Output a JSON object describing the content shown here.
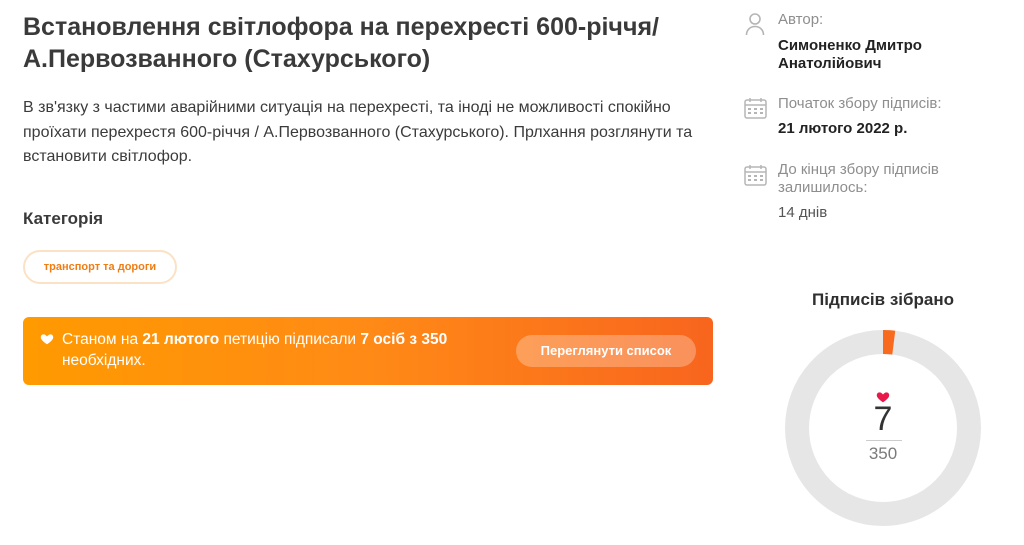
{
  "petition": {
    "title": "Встановлення світлофора на перехресті 600-річчя/ А.Первозванного (Стахурського)",
    "description": "В зв'язку з частими аварійними ситуація на перехресті, та іноді не можливості спокійно проїхати перехрестя 600-річчя / А.Первозванного (Стахурського). Прлхання розглянути та встановити світлофор."
  },
  "category": {
    "heading": "Категорія",
    "tag": "транспорт та дороги"
  },
  "banner": {
    "prefix": "Станом на ",
    "date": "21 лютого",
    "middle": " петицію підписали ",
    "count_text": "7 осіб з 350",
    "suffix": " необхідних.",
    "button_label": "Переглянути список",
    "icon": "heart-icon"
  },
  "meta": {
    "author_label": "Автор:",
    "author_name": "Симоненко Дмитро Анатолійович",
    "start_label": "Початок збору підписів:",
    "start_date": "21 лютого 2022 р.",
    "remaining_label": "До кінця збору підписів залишилось:",
    "remaining_value": "14 днів"
  },
  "signatures": {
    "title": "Підписів зібрано",
    "collected": "7",
    "goal": "350",
    "progress_fraction": 0.02
  },
  "colors": {
    "accent": "#f07d14",
    "banner_start": "#ff9a00",
    "banner_end": "#f8651e",
    "heart": "#e8194a",
    "ring_track": "#e6e6e6",
    "ring_fill": "#f86a1d"
  }
}
